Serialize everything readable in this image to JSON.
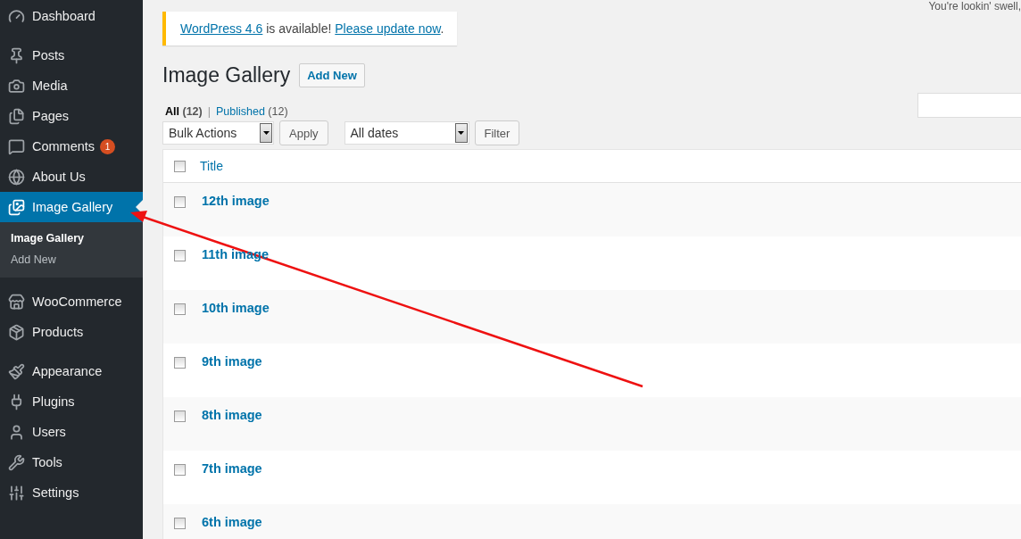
{
  "sidebar": {
    "groups": [
      [
        {
          "label": "Dashboard",
          "selected": false
        }
      ],
      [
        {
          "label": "Posts",
          "selected": false
        },
        {
          "label": "Media",
          "selected": false
        },
        {
          "label": "Pages",
          "selected": false
        },
        {
          "label": "Comments",
          "selected": false,
          "badge": "1"
        },
        {
          "label": "About Us",
          "selected": false
        },
        {
          "label": "Image Gallery",
          "selected": true,
          "children": [
            {
              "label": "Image Gallery",
              "selected": true
            },
            {
              "label": "Add New",
              "selected": false
            }
          ]
        }
      ],
      [
        {
          "label": "WooCommerce",
          "selected": false
        },
        {
          "label": "Products",
          "selected": false
        }
      ],
      [
        {
          "label": "Appearance",
          "selected": false
        },
        {
          "label": "Plugins",
          "selected": false
        },
        {
          "label": "Users",
          "selected": false
        },
        {
          "label": "Tools",
          "selected": false
        },
        {
          "label": "Settings",
          "selected": false
        }
      ]
    ]
  },
  "notice": {
    "link": "WordPress 4.6",
    "text": " is available! ",
    "action": "Please update now",
    "end": "."
  },
  "greeting": "You're lookin' swell,",
  "heading": {
    "title": "Image Gallery",
    "button": "Add New"
  },
  "filters": [
    {
      "label": "All",
      "count": "(12)",
      "selected": true
    },
    {
      "label": "Published",
      "count": "(12)",
      "selected": false
    }
  ],
  "separator": "|",
  "bulk_actions": {
    "value": "Bulk Actions",
    "button": "Apply"
  },
  "dates": {
    "value": "All dates",
    "button": "Filter"
  },
  "table": {
    "columns": [
      {
        "label": "Title",
        "checked": false
      }
    ],
    "rows": [
      {
        "title": "12th image",
        "checked": false
      },
      {
        "title": "11th image",
        "checked": false
      },
      {
        "title": "10th image",
        "checked": false
      },
      {
        "title": "9th image",
        "checked": false
      },
      {
        "title": "8th image",
        "checked": false
      },
      {
        "title": "7th image",
        "checked": false
      },
      {
        "title": "6th image",
        "checked": false
      }
    ]
  }
}
